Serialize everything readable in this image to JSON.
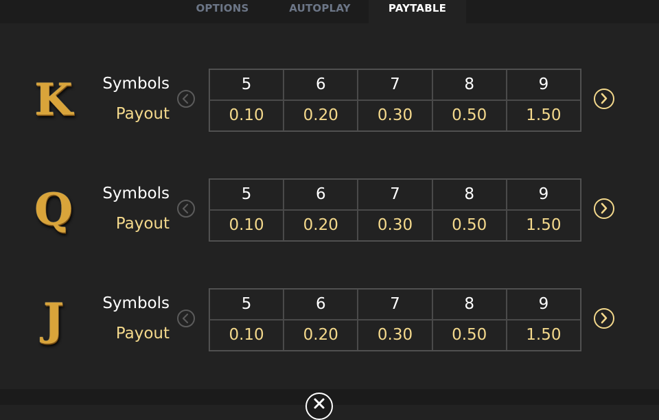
{
  "tabs": [
    {
      "label": "OPTIONS"
    },
    {
      "label": "AUTOPLAY"
    },
    {
      "label": "PAYTABLE"
    }
  ],
  "labels": {
    "symbols": "Symbols",
    "payout": "Payout"
  },
  "rows": [
    {
      "symbol": "K",
      "counts": [
        "5",
        "6",
        "7",
        "8",
        "9"
      ],
      "payouts": [
        "0.10",
        "0.20",
        "0.30",
        "0.50",
        "1.50"
      ]
    },
    {
      "symbol": "Q",
      "counts": [
        "5",
        "6",
        "7",
        "8",
        "9"
      ],
      "payouts": [
        "0.10",
        "0.20",
        "0.30",
        "0.50",
        "1.50"
      ]
    },
    {
      "symbol": "J",
      "counts": [
        "5",
        "6",
        "7",
        "8",
        "9"
      ],
      "payouts": [
        "0.10",
        "0.20",
        "0.30",
        "0.50",
        "1.50"
      ]
    }
  ],
  "icons": {
    "prev": "chevron-left-icon",
    "next": "chevron-right-icon",
    "close": "close-icon"
  },
  "colors": {
    "background": "#222222",
    "gold": "#f4d98c",
    "tab_inactive": "#6c7687"
  }
}
